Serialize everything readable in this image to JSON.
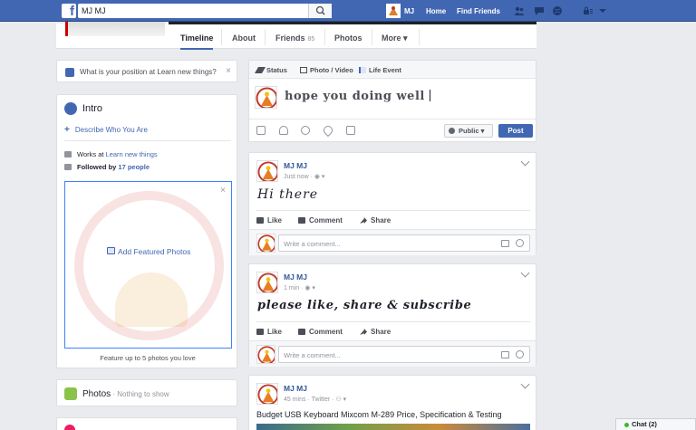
{
  "topbar": {
    "logo": "f",
    "search_value": "MJ MJ",
    "user_name": "MJ",
    "home_label": "Home",
    "find_friends_label": "Find Friends"
  },
  "profile_tabs": {
    "timeline": "Timeline",
    "about": "About",
    "friends": "Friends",
    "friends_count": "85",
    "photos": "Photos",
    "more": "More ▾"
  },
  "ask_box": {
    "question": "What is your position at Learn new things?"
  },
  "intro": {
    "title": "Intro",
    "add_bio": "Describe Who You Are",
    "works_prefix": "Works at ",
    "works_link": "Learn new things",
    "followed_prefix": "Followed by ",
    "followed_link": "17 people",
    "add_featured": "Add Featured Photos",
    "featured_caption": "Feature up to 5 photos you love"
  },
  "photos_section": {
    "title": "Photos",
    "subtitle": " · Nothing to show"
  },
  "composer": {
    "tab_status": "Status",
    "tab_photo": "Photo / Video",
    "tab_life": "Life Event",
    "text": "hope you doing well",
    "audience": "Public ▾",
    "post_label": "Post"
  },
  "posts": [
    {
      "author": "MJ MJ",
      "meta": "Just now · ◉ ▾",
      "body": "Hi there"
    },
    {
      "author": "MJ MJ",
      "meta": "1 min · ◉ ▾",
      "body": "please like, share & subscribe"
    },
    {
      "author": "MJ MJ",
      "meta": "45 mins · Twitter · ⚇ ▾",
      "body": "Budget USB Keyboard Mixcom M-289 Price, Specification & Testing"
    }
  ],
  "post_actions": {
    "like": "Like",
    "comment": "Comment",
    "share": "Share"
  },
  "comment_placeholder": "Write a comment...",
  "chat": {
    "label": "Chat (2)"
  },
  "close_symbol": "×"
}
